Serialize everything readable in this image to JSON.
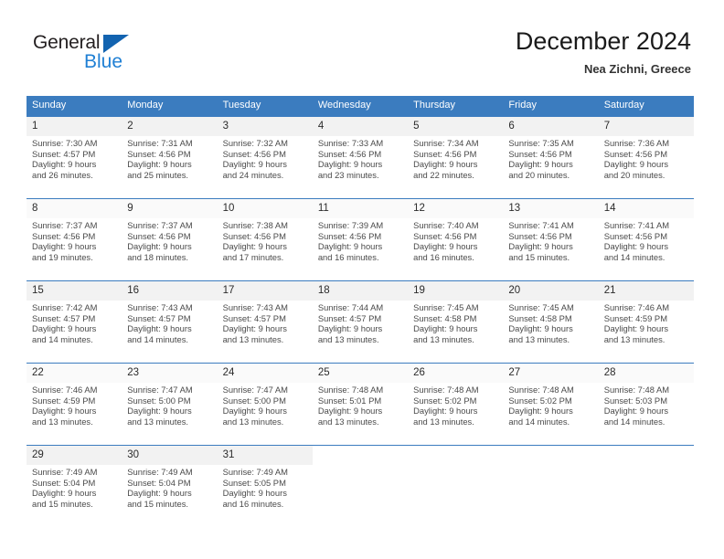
{
  "brand": {
    "name_part1": "General",
    "name_part2": "Blue",
    "accent_color": "#1f7fd4",
    "triangle_color": "#1263b0"
  },
  "header": {
    "title": "December 2024",
    "subtitle": "Nea Zichni, Greece"
  },
  "calendar": {
    "header_bg": "#3b7cbf",
    "weekday_headers": [
      "Sunday",
      "Monday",
      "Tuesday",
      "Wednesday",
      "Thursday",
      "Friday",
      "Saturday"
    ],
    "weeks": [
      [
        {
          "day": "1",
          "sunrise": "Sunrise: 7:30 AM",
          "sunset": "Sunset: 4:57 PM",
          "daylight_line1": "Daylight: 9 hours",
          "daylight_line2": "and 26 minutes."
        },
        {
          "day": "2",
          "sunrise": "Sunrise: 7:31 AM",
          "sunset": "Sunset: 4:56 PM",
          "daylight_line1": "Daylight: 9 hours",
          "daylight_line2": "and 25 minutes."
        },
        {
          "day": "3",
          "sunrise": "Sunrise: 7:32 AM",
          "sunset": "Sunset: 4:56 PM",
          "daylight_line1": "Daylight: 9 hours",
          "daylight_line2": "and 24 minutes."
        },
        {
          "day": "4",
          "sunrise": "Sunrise: 7:33 AM",
          "sunset": "Sunset: 4:56 PM",
          "daylight_line1": "Daylight: 9 hours",
          "daylight_line2": "and 23 minutes."
        },
        {
          "day": "5",
          "sunrise": "Sunrise: 7:34 AM",
          "sunset": "Sunset: 4:56 PM",
          "daylight_line1": "Daylight: 9 hours",
          "daylight_line2": "and 22 minutes."
        },
        {
          "day": "6",
          "sunrise": "Sunrise: 7:35 AM",
          "sunset": "Sunset: 4:56 PM",
          "daylight_line1": "Daylight: 9 hours",
          "daylight_line2": "and 20 minutes."
        },
        {
          "day": "7",
          "sunrise": "Sunrise: 7:36 AM",
          "sunset": "Sunset: 4:56 PM",
          "daylight_line1": "Daylight: 9 hours",
          "daylight_line2": "and 20 minutes."
        }
      ],
      [
        {
          "day": "8",
          "sunrise": "Sunrise: 7:37 AM",
          "sunset": "Sunset: 4:56 PM",
          "daylight_line1": "Daylight: 9 hours",
          "daylight_line2": "and 19 minutes."
        },
        {
          "day": "9",
          "sunrise": "Sunrise: 7:37 AM",
          "sunset": "Sunset: 4:56 PM",
          "daylight_line1": "Daylight: 9 hours",
          "daylight_line2": "and 18 minutes."
        },
        {
          "day": "10",
          "sunrise": "Sunrise: 7:38 AM",
          "sunset": "Sunset: 4:56 PM",
          "daylight_line1": "Daylight: 9 hours",
          "daylight_line2": "and 17 minutes."
        },
        {
          "day": "11",
          "sunrise": "Sunrise: 7:39 AM",
          "sunset": "Sunset: 4:56 PM",
          "daylight_line1": "Daylight: 9 hours",
          "daylight_line2": "and 16 minutes."
        },
        {
          "day": "12",
          "sunrise": "Sunrise: 7:40 AM",
          "sunset": "Sunset: 4:56 PM",
          "daylight_line1": "Daylight: 9 hours",
          "daylight_line2": "and 16 minutes."
        },
        {
          "day": "13",
          "sunrise": "Sunrise: 7:41 AM",
          "sunset": "Sunset: 4:56 PM",
          "daylight_line1": "Daylight: 9 hours",
          "daylight_line2": "and 15 minutes."
        },
        {
          "day": "14",
          "sunrise": "Sunrise: 7:41 AM",
          "sunset": "Sunset: 4:56 PM",
          "daylight_line1": "Daylight: 9 hours",
          "daylight_line2": "and 14 minutes."
        }
      ],
      [
        {
          "day": "15",
          "sunrise": "Sunrise: 7:42 AM",
          "sunset": "Sunset: 4:57 PM",
          "daylight_line1": "Daylight: 9 hours",
          "daylight_line2": "and 14 minutes."
        },
        {
          "day": "16",
          "sunrise": "Sunrise: 7:43 AM",
          "sunset": "Sunset: 4:57 PM",
          "daylight_line1": "Daylight: 9 hours",
          "daylight_line2": "and 14 minutes."
        },
        {
          "day": "17",
          "sunrise": "Sunrise: 7:43 AM",
          "sunset": "Sunset: 4:57 PM",
          "daylight_line1": "Daylight: 9 hours",
          "daylight_line2": "and 13 minutes."
        },
        {
          "day": "18",
          "sunrise": "Sunrise: 7:44 AM",
          "sunset": "Sunset: 4:57 PM",
          "daylight_line1": "Daylight: 9 hours",
          "daylight_line2": "and 13 minutes."
        },
        {
          "day": "19",
          "sunrise": "Sunrise: 7:45 AM",
          "sunset": "Sunset: 4:58 PM",
          "daylight_line1": "Daylight: 9 hours",
          "daylight_line2": "and 13 minutes."
        },
        {
          "day": "20",
          "sunrise": "Sunrise: 7:45 AM",
          "sunset": "Sunset: 4:58 PM",
          "daylight_line1": "Daylight: 9 hours",
          "daylight_line2": "and 13 minutes."
        },
        {
          "day": "21",
          "sunrise": "Sunrise: 7:46 AM",
          "sunset": "Sunset: 4:59 PM",
          "daylight_line1": "Daylight: 9 hours",
          "daylight_line2": "and 13 minutes."
        }
      ],
      [
        {
          "day": "22",
          "sunrise": "Sunrise: 7:46 AM",
          "sunset": "Sunset: 4:59 PM",
          "daylight_line1": "Daylight: 9 hours",
          "daylight_line2": "and 13 minutes."
        },
        {
          "day": "23",
          "sunrise": "Sunrise: 7:47 AM",
          "sunset": "Sunset: 5:00 PM",
          "daylight_line1": "Daylight: 9 hours",
          "daylight_line2": "and 13 minutes."
        },
        {
          "day": "24",
          "sunrise": "Sunrise: 7:47 AM",
          "sunset": "Sunset: 5:00 PM",
          "daylight_line1": "Daylight: 9 hours",
          "daylight_line2": "and 13 minutes."
        },
        {
          "day": "25",
          "sunrise": "Sunrise: 7:48 AM",
          "sunset": "Sunset: 5:01 PM",
          "daylight_line1": "Daylight: 9 hours",
          "daylight_line2": "and 13 minutes."
        },
        {
          "day": "26",
          "sunrise": "Sunrise: 7:48 AM",
          "sunset": "Sunset: 5:02 PM",
          "daylight_line1": "Daylight: 9 hours",
          "daylight_line2": "and 13 minutes."
        },
        {
          "day": "27",
          "sunrise": "Sunrise: 7:48 AM",
          "sunset": "Sunset: 5:02 PM",
          "daylight_line1": "Daylight: 9 hours",
          "daylight_line2": "and 14 minutes."
        },
        {
          "day": "28",
          "sunrise": "Sunrise: 7:48 AM",
          "sunset": "Sunset: 5:03 PM",
          "daylight_line1": "Daylight: 9 hours",
          "daylight_line2": "and 14 minutes."
        }
      ],
      [
        {
          "day": "29",
          "sunrise": "Sunrise: 7:49 AM",
          "sunset": "Sunset: 5:04 PM",
          "daylight_line1": "Daylight: 9 hours",
          "daylight_line2": "and 15 minutes."
        },
        {
          "day": "30",
          "sunrise": "Sunrise: 7:49 AM",
          "sunset": "Sunset: 5:04 PM",
          "daylight_line1": "Daylight: 9 hours",
          "daylight_line2": "and 15 minutes."
        },
        {
          "day": "31",
          "sunrise": "Sunrise: 7:49 AM",
          "sunset": "Sunset: 5:05 PM",
          "daylight_line1": "Daylight: 9 hours",
          "daylight_line2": "and 16 minutes."
        },
        {
          "day": "",
          "sunrise": "",
          "sunset": "",
          "daylight_line1": "",
          "daylight_line2": ""
        },
        {
          "day": "",
          "sunrise": "",
          "sunset": "",
          "daylight_line1": "",
          "daylight_line2": ""
        },
        {
          "day": "",
          "sunrise": "",
          "sunset": "",
          "daylight_line1": "",
          "daylight_line2": ""
        },
        {
          "day": "",
          "sunrise": "",
          "sunset": "",
          "daylight_line1": "",
          "daylight_line2": ""
        }
      ]
    ]
  }
}
